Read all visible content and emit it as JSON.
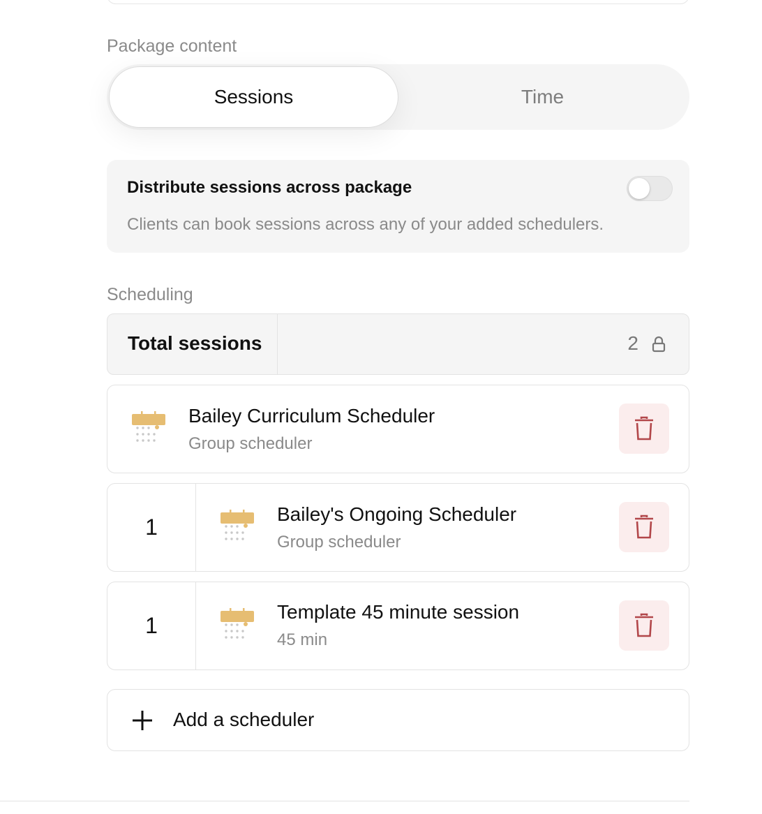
{
  "package_content": {
    "label": "Package content",
    "options": [
      {
        "label": "Sessions",
        "selected": true
      },
      {
        "label": "Time",
        "selected": false
      }
    ]
  },
  "distribute": {
    "title": "Distribute sessions across package",
    "description": "Clients can book sessions across any of your added schedulers.",
    "enabled": false
  },
  "scheduling": {
    "label": "Scheduling",
    "total_label": "Total sessions",
    "total_value": "2",
    "total_icon": "lock-icon",
    "items": [
      {
        "count": "",
        "name": "Bailey Curriculum Scheduler",
        "subtitle": "Group scheduler",
        "icon": "calendar-icon"
      },
      {
        "count": "1",
        "name": "Bailey's Ongoing Scheduler",
        "subtitle": "Group scheduler",
        "icon": "calendar-icon"
      },
      {
        "count": "1",
        "name": "Template 45 minute session",
        "subtitle": "45 min",
        "icon": "calendar-icon"
      }
    ],
    "add_label": "Add a scheduler"
  },
  "colors": {
    "calendar_accent": "#e6bd72",
    "delete_icon": "#b2474a",
    "delete_bg": "#fbeded"
  }
}
